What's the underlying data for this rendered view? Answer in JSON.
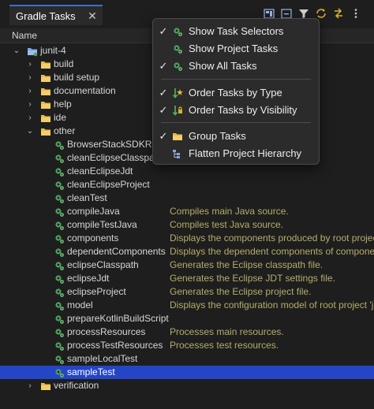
{
  "tab": {
    "title": "Gradle Tasks",
    "close": "✕"
  },
  "toolbar": {
    "icons": [
      "new-project-icon",
      "collapse-all-icon",
      "filter-icon",
      "sync-icon",
      "link-icon",
      "view-menu-icon"
    ]
  },
  "header": {
    "column": "Name"
  },
  "tree": {
    "root": {
      "label": "junit-4"
    },
    "folders": [
      "build",
      "build setup",
      "documentation",
      "help",
      "ide",
      "other"
    ],
    "other_tasks": [
      {
        "name": "BrowserStackSDKRu",
        "desc": ""
      },
      {
        "name": "cleanEclipseClasspat",
        "desc": ""
      },
      {
        "name": "cleanEclipseJdt",
        "desc": ""
      },
      {
        "name": "cleanEclipseProject",
        "desc": ""
      },
      {
        "name": "cleanTest",
        "desc": ""
      },
      {
        "name": "compileJava",
        "desc": "Compiles main Java source."
      },
      {
        "name": "compileTestJava",
        "desc": "Compiles test Java source."
      },
      {
        "name": "components",
        "desc": "Displays the components produced by root projec"
      },
      {
        "name": "dependentComponents",
        "desc": "Displays the dependent components of componer"
      },
      {
        "name": "eclipseClasspath",
        "desc": "Generates the Eclipse classpath file."
      },
      {
        "name": "eclipseJdt",
        "desc": "Generates the Eclipse JDT settings file."
      },
      {
        "name": "eclipseProject",
        "desc": "Generates the Eclipse project file."
      },
      {
        "name": "model",
        "desc": "Displays the configuration model of root project 'j"
      },
      {
        "name": "prepareKotlinBuildScript",
        "desc": ""
      },
      {
        "name": "processResources",
        "desc": "Processes main resources."
      },
      {
        "name": "processTestResources",
        "desc": "Processes test resources."
      },
      {
        "name": "sampleLocalTest",
        "desc": ""
      },
      {
        "name": "sampleTest",
        "desc": ""
      }
    ],
    "selected": "sampleTest",
    "last_folder": "verification"
  },
  "menu": {
    "items": [
      {
        "label": "Show Task Selectors",
        "checked": true,
        "icon": "gear-icon"
      },
      {
        "label": "Show Project Tasks",
        "checked": false,
        "icon": "gear-icon"
      },
      {
        "label": "Show All Tasks",
        "checked": true,
        "icon": "gear-icon"
      },
      {
        "label": "Order Tasks by Type",
        "checked": true,
        "icon": "sort-type-icon"
      },
      {
        "label": "Order Tasks by Visibility",
        "checked": true,
        "icon": "sort-visibility-icon"
      },
      {
        "label": "Group Tasks",
        "checked": true,
        "icon": "folder-icon"
      },
      {
        "label": "Flatten Project Hierarchy",
        "checked": false,
        "icon": "flatten-icon"
      }
    ],
    "check_glyph": "✓"
  },
  "colors": {
    "selection": "#2545c7",
    "description": "#b5ad6a",
    "tab_accent": "#3c6ed1"
  }
}
